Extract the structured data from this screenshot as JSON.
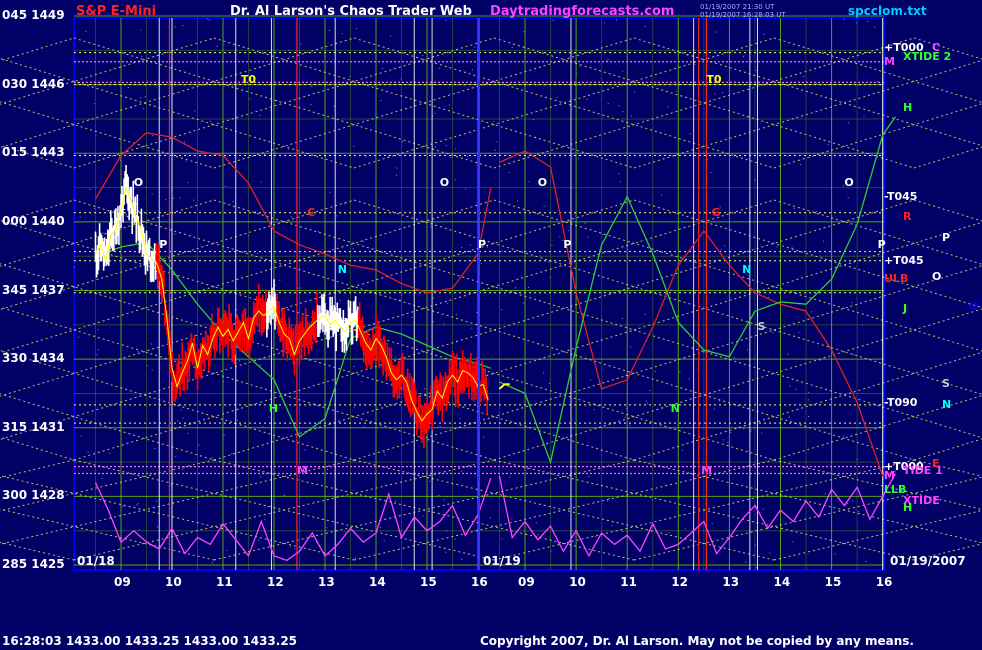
{
  "header": {
    "symbol": "S&P E-Mini",
    "title": "Dr. Al Larson's Chaos Trader Web",
    "site": "Daytradingforecasts.com",
    "stamp_line1": "01/19/2007 21:30 UT",
    "stamp_line2": "01/19/2007 16:28:03 UT",
    "file": "spcclom.txt"
  },
  "footer": {
    "quote": "16:28:03  1433.00  1433.25  1433.00  1433.25",
    "copyright": "Copyright 2007, Dr. Al Larson. May not be copied by any means."
  },
  "colors": {
    "background": "#000066",
    "frame": "#0000ff",
    "grid_green": "#66cc00",
    "white_line": "#ffffff",
    "red_line": "#ff2222",
    "dotted_yellow": "#ffff66",
    "dotted_magenta": "#ff66ff",
    "green_curve": "#33cc33",
    "red_curve": "#dd2222",
    "magenta_curve": "#ff44ff",
    "bar_white": "#ffffff",
    "bar_red": "#ff0000",
    "bar_yellow": "#ffff00"
  },
  "chart_data": {
    "type": "line",
    "title": "S&P E-Mini",
    "xlabel": "",
    "ylabel": "",
    "grid": true,
    "y_labels": [
      "045 1449",
      "030 1446",
      "015 1443",
      "000 1440",
      "345 1437",
      "330 1434",
      "315 1431",
      "300 1428",
      "285 1425"
    ],
    "ylim": [
      1425,
      1449
    ],
    "x_ticks": [
      "09",
      "10",
      "11",
      "12",
      "13",
      "14",
      "15",
      "16",
      "09",
      "10",
      "11",
      "12",
      "13",
      "14",
      "15",
      "16"
    ],
    "dates": [
      "01/18",
      "01/19",
      "01/19/2007"
    ],
    "session_hours": [
      8.5,
      16.25
    ],
    "price_series": [
      {
        "t": 8.5,
        "v": 1438.6
      },
      {
        "t": 8.6,
        "v": 1439.0
      },
      {
        "t": 8.7,
        "v": 1438.3
      },
      {
        "t": 8.8,
        "v": 1439.4
      },
      {
        "t": 8.9,
        "v": 1439.7
      },
      {
        "t": 9.0,
        "v": 1440.5
      },
      {
        "t": 9.1,
        "v": 1441.5
      },
      {
        "t": 9.2,
        "v": 1440.9
      },
      {
        "t": 9.3,
        "v": 1440.2
      },
      {
        "t": 9.4,
        "v": 1439.6
      },
      {
        "t": 9.5,
        "v": 1438.6
      },
      {
        "t": 9.6,
        "v": 1438.4
      },
      {
        "t": 9.7,
        "v": 1438.2
      },
      {
        "t": 9.8,
        "v": 1437.5
      },
      {
        "t": 9.9,
        "v": 1435.8
      },
      {
        "t": 10.0,
        "v": 1433.6
      },
      {
        "t": 10.1,
        "v": 1432.8
      },
      {
        "t": 10.2,
        "v": 1433.4
      },
      {
        "t": 10.3,
        "v": 1433.9
      },
      {
        "t": 10.4,
        "v": 1434.7
      },
      {
        "t": 10.5,
        "v": 1433.6
      },
      {
        "t": 10.6,
        "v": 1434.6
      },
      {
        "t": 10.7,
        "v": 1434.2
      },
      {
        "t": 10.8,
        "v": 1434.9
      },
      {
        "t": 10.9,
        "v": 1435.4
      },
      {
        "t": 11.0,
        "v": 1435.0
      },
      {
        "t": 11.1,
        "v": 1435.3
      },
      {
        "t": 11.2,
        "v": 1434.8
      },
      {
        "t": 11.3,
        "v": 1435.2
      },
      {
        "t": 11.4,
        "v": 1435.6
      },
      {
        "t": 11.5,
        "v": 1434.9
      },
      {
        "t": 11.6,
        "v": 1435.8
      },
      {
        "t": 11.7,
        "v": 1436.1
      },
      {
        "t": 11.8,
        "v": 1435.9
      },
      {
        "t": 11.9,
        "v": 1436.1
      },
      {
        "t": 12.0,
        "v": 1436.3
      },
      {
        "t": 12.1,
        "v": 1435.6
      },
      {
        "t": 12.2,
        "v": 1435.1
      },
      {
        "t": 12.3,
        "v": 1434.9
      },
      {
        "t": 12.4,
        "v": 1434.2
      },
      {
        "t": 12.5,
        "v": 1434.8
      },
      {
        "t": 12.6,
        "v": 1435.1
      },
      {
        "t": 12.7,
        "v": 1435.4
      },
      {
        "t": 12.8,
        "v": 1435.6
      },
      {
        "t": 12.9,
        "v": 1435.8
      },
      {
        "t": 13.0,
        "v": 1435.9
      },
      {
        "t": 13.1,
        "v": 1435.5
      },
      {
        "t": 13.2,
        "v": 1435.7
      },
      {
        "t": 13.3,
        "v": 1435.4
      },
      {
        "t": 13.4,
        "v": 1435.2
      },
      {
        "t": 13.5,
        "v": 1435.6
      },
      {
        "t": 13.6,
        "v": 1435.7
      },
      {
        "t": 13.7,
        "v": 1435.2
      },
      {
        "t": 13.8,
        "v": 1434.7
      },
      {
        "t": 13.9,
        "v": 1434.4
      },
      {
        "t": 14.0,
        "v": 1434.9
      },
      {
        "t": 14.1,
        "v": 1434.6
      },
      {
        "t": 14.2,
        "v": 1434.1
      },
      {
        "t": 14.3,
        "v": 1433.4
      },
      {
        "t": 14.4,
        "v": 1433.1
      },
      {
        "t": 14.5,
        "v": 1433.3
      },
      {
        "t": 14.6,
        "v": 1433.0
      },
      {
        "t": 14.7,
        "v": 1432.2
      },
      {
        "t": 14.8,
        "v": 1431.7
      },
      {
        "t": 14.9,
        "v": 1431.3
      },
      {
        "t": 15.0,
        "v": 1431.6
      },
      {
        "t": 15.1,
        "v": 1431.8
      },
      {
        "t": 15.2,
        "v": 1432.6
      },
      {
        "t": 15.3,
        "v": 1432.3
      },
      {
        "t": 15.4,
        "v": 1433.0
      },
      {
        "t": 15.5,
        "v": 1433.3
      },
      {
        "t": 15.6,
        "v": 1433.0
      },
      {
        "t": 15.7,
        "v": 1433.5
      },
      {
        "t": 15.8,
        "v": 1433.4
      },
      {
        "t": 15.9,
        "v": 1433.2
      },
      {
        "t": 16.0,
        "v": 1432.8
      },
      {
        "t": 16.1,
        "v": 1432.9
      },
      {
        "t": 16.2,
        "v": 1432.2
      }
    ],
    "today_tail": [
      {
        "t": 8.5,
        "v": 1432.7
      },
      {
        "t": 8.6,
        "v": 1432.9
      },
      {
        "t": 8.7,
        "v": 1432.9
      }
    ],
    "green_curve_day1": [
      {
        "t": 8.5,
        "v": 1438.5
      },
      {
        "t": 9.0,
        "v": 1438.9
      },
      {
        "t": 9.5,
        "v": 1439.1
      },
      {
        "t": 10.0,
        "v": 1437.9
      },
      {
        "t": 10.5,
        "v": 1436.4
      },
      {
        "t": 11.0,
        "v": 1435.1
      },
      {
        "t": 11.5,
        "v": 1434.1
      },
      {
        "t": 12.0,
        "v": 1433.1
      },
      {
        "t": 12.5,
        "v": 1430.6
      },
      {
        "t": 13.0,
        "v": 1431.4
      },
      {
        "t": 13.5,
        "v": 1434.9
      },
      {
        "t": 14.0,
        "v": 1435.4
      },
      {
        "t": 14.5,
        "v": 1435.1
      },
      {
        "t": 15.0,
        "v": 1434.6
      },
      {
        "t": 15.5,
        "v": 1434.1
      },
      {
        "t": 16.0,
        "v": 1433.8
      },
      {
        "t": 16.25,
        "v": 1433.6
      }
    ],
    "green_curve_day2": [
      {
        "t": 8.5,
        "v": 1433.0
      },
      {
        "t": 9.0,
        "v": 1432.5
      },
      {
        "t": 9.5,
        "v": 1429.5
      },
      {
        "t": 10.0,
        "v": 1434.5
      },
      {
        "t": 10.5,
        "v": 1439.0
      },
      {
        "t": 11.0,
        "v": 1441.1
      },
      {
        "t": 11.5,
        "v": 1438.6
      },
      {
        "t": 12.0,
        "v": 1435.6
      },
      {
        "t": 12.5,
        "v": 1434.4
      },
      {
        "t": 13.0,
        "v": 1434.1
      },
      {
        "t": 13.5,
        "v": 1436.1
      },
      {
        "t": 14.0,
        "v": 1436.5
      },
      {
        "t": 14.5,
        "v": 1436.4
      },
      {
        "t": 15.0,
        "v": 1437.5
      },
      {
        "t": 15.5,
        "v": 1439.9
      },
      {
        "t": 16.0,
        "v": 1443.8
      },
      {
        "t": 16.25,
        "v": 1444.6
      }
    ],
    "red_curve_day1": [
      {
        "t": 8.5,
        "v": 1441.0
      },
      {
        "t": 9.0,
        "v": 1442.9
      },
      {
        "t": 9.5,
        "v": 1443.9
      },
      {
        "t": 10.0,
        "v": 1443.7
      },
      {
        "t": 10.5,
        "v": 1443.1
      },
      {
        "t": 11.0,
        "v": 1442.9
      },
      {
        "t": 11.5,
        "v": 1441.7
      },
      {
        "t": 12.0,
        "v": 1439.6
      },
      {
        "t": 12.5,
        "v": 1439.0
      },
      {
        "t": 13.0,
        "v": 1438.6
      },
      {
        "t": 13.5,
        "v": 1438.1
      },
      {
        "t": 14.0,
        "v": 1437.9
      },
      {
        "t": 14.5,
        "v": 1437.3
      },
      {
        "t": 15.0,
        "v": 1436.9
      },
      {
        "t": 15.5,
        "v": 1437.1
      },
      {
        "t": 16.0,
        "v": 1438.6
      },
      {
        "t": 16.25,
        "v": 1441.5
      }
    ],
    "red_curve_day2": [
      {
        "t": 8.5,
        "v": 1442.6
      },
      {
        "t": 9.0,
        "v": 1443.1
      },
      {
        "t": 9.5,
        "v": 1442.4
      },
      {
        "t": 10.0,
        "v": 1436.9
      },
      {
        "t": 10.5,
        "v": 1432.7
      },
      {
        "t": 11.0,
        "v": 1433.1
      },
      {
        "t": 11.5,
        "v": 1435.4
      },
      {
        "t": 12.0,
        "v": 1438.1
      },
      {
        "t": 12.5,
        "v": 1439.6
      },
      {
        "t": 13.0,
        "v": 1438.1
      },
      {
        "t": 13.5,
        "v": 1436.9
      },
      {
        "t": 14.0,
        "v": 1436.4
      },
      {
        "t": 14.5,
        "v": 1436.1
      },
      {
        "t": 15.0,
        "v": 1434.4
      },
      {
        "t": 15.5,
        "v": 1432.1
      },
      {
        "t": 16.0,
        "v": 1428.9
      },
      {
        "t": 16.25,
        "v": 1429.1
      }
    ],
    "magenta_curve_day1": [
      {
        "t": 8.5,
        "v": 1428.6
      },
      {
        "t": 8.75,
        "v": 1427.4
      },
      {
        "t": 9.0,
        "v": 1426.0
      },
      {
        "t": 9.25,
        "v": 1426.5
      },
      {
        "t": 9.5,
        "v": 1426.0
      },
      {
        "t": 9.75,
        "v": 1425.7
      },
      {
        "t": 10.0,
        "v": 1426.6
      },
      {
        "t": 10.25,
        "v": 1425.5
      },
      {
        "t": 10.5,
        "v": 1426.2
      },
      {
        "t": 10.75,
        "v": 1425.9
      },
      {
        "t": 11.0,
        "v": 1426.8
      },
      {
        "t": 11.25,
        "v": 1426.1
      },
      {
        "t": 11.5,
        "v": 1425.4
      },
      {
        "t": 11.75,
        "v": 1426.9
      },
      {
        "t": 12.0,
        "v": 1425.4
      },
      {
        "t": 12.25,
        "v": 1425.2
      },
      {
        "t": 12.5,
        "v": 1425.6
      },
      {
        "t": 12.75,
        "v": 1426.4
      },
      {
        "t": 13.0,
        "v": 1425.4
      },
      {
        "t": 13.25,
        "v": 1425.9
      },
      {
        "t": 13.5,
        "v": 1426.6
      },
      {
        "t": 13.75,
        "v": 1426.0
      },
      {
        "t": 14.0,
        "v": 1426.4
      },
      {
        "t": 14.25,
        "v": 1428.1
      },
      {
        "t": 14.5,
        "v": 1426.2
      },
      {
        "t": 14.75,
        "v": 1427.1
      },
      {
        "t": 15.0,
        "v": 1426.5
      },
      {
        "t": 15.25,
        "v": 1426.9
      },
      {
        "t": 15.5,
        "v": 1427.6
      },
      {
        "t": 15.75,
        "v": 1426.3
      },
      {
        "t": 16.0,
        "v": 1427.2
      },
      {
        "t": 16.25,
        "v": 1428.8
      }
    ],
    "magenta_curve_day2": [
      {
        "t": 8.5,
        "v": 1428.9
      },
      {
        "t": 8.75,
        "v": 1426.2
      },
      {
        "t": 9.0,
        "v": 1426.9
      },
      {
        "t": 9.25,
        "v": 1426.1
      },
      {
        "t": 9.5,
        "v": 1426.7
      },
      {
        "t": 9.75,
        "v": 1425.6
      },
      {
        "t": 10.0,
        "v": 1426.5
      },
      {
        "t": 10.25,
        "v": 1425.4
      },
      {
        "t": 10.5,
        "v": 1426.4
      },
      {
        "t": 10.75,
        "v": 1425.9
      },
      {
        "t": 11.0,
        "v": 1426.3
      },
      {
        "t": 11.25,
        "v": 1425.6
      },
      {
        "t": 11.5,
        "v": 1426.8
      },
      {
        "t": 11.75,
        "v": 1425.7
      },
      {
        "t": 12.0,
        "v": 1425.9
      },
      {
        "t": 12.25,
        "v": 1426.4
      },
      {
        "t": 12.5,
        "v": 1426.9
      },
      {
        "t": 12.75,
        "v": 1425.5
      },
      {
        "t": 13.0,
        "v": 1426.2
      },
      {
        "t": 13.25,
        "v": 1427.0
      },
      {
        "t": 13.5,
        "v": 1427.6
      },
      {
        "t": 13.75,
        "v": 1426.6
      },
      {
        "t": 14.0,
        "v": 1427.4
      },
      {
        "t": 14.25,
        "v": 1426.9
      },
      {
        "t": 14.5,
        "v": 1427.8
      },
      {
        "t": 14.75,
        "v": 1427.1
      },
      {
        "t": 15.0,
        "v": 1428.3
      },
      {
        "t": 15.25,
        "v": 1427.6
      },
      {
        "t": 15.5,
        "v": 1428.4
      },
      {
        "t": 15.75,
        "v": 1427.0
      },
      {
        "t": 16.0,
        "v": 1428.0
      },
      {
        "t": 16.25,
        "v": 1429.0
      }
    ],
    "vertical_markers": {
      "white_day1": [
        9.75,
        10.0,
        11.25,
        11.95,
        13.2,
        14.75,
        15.1
      ],
      "red_day1": [
        9.95,
        12.45
      ],
      "white_day2": [
        9.9,
        12.3,
        13.4,
        13.55,
        16.0
      ],
      "red_day2": [
        12.4,
        12.55
      ]
    },
    "hlines_dotted_magenta": [
      1447.0,
      1446.1,
      1429.3,
      1429.0
    ],
    "hlines_dotted_yellow": [
      1447.4,
      1446.0,
      1442.9,
      1440.4,
      1438.7,
      1438.3,
      1436.9,
      1432.0,
      1431.2
    ],
    "annotations_day1": [
      {
        "text": "T0",
        "t": 11.35,
        "v": 1446.2,
        "color": "#ffff00"
      },
      {
        "text": "O",
        "t": 9.25,
        "v": 1441.7,
        "color": "#ffffff"
      },
      {
        "text": "O",
        "t": 15.25,
        "v": 1441.7,
        "color": "#ffffff"
      },
      {
        "text": "P",
        "t": 9.75,
        "v": 1439.0,
        "color": "#ffffff"
      },
      {
        "text": "P",
        "t": 16.0,
        "v": 1439.0,
        "color": "#ffffff"
      },
      {
        "text": "C",
        "t": 12.65,
        "v": 1440.4,
        "color": "#ff2222"
      },
      {
        "text": "N",
        "t": 13.25,
        "v": 1437.9,
        "color": "#00ffff"
      },
      {
        "text": "H",
        "t": 11.9,
        "v": 1431.8,
        "color": "#33ff33"
      },
      {
        "text": "M",
        "t": 12.45,
        "v": 1429.1,
        "color": "#ff44ff"
      }
    ],
    "annotations_day2": [
      {
        "text": "T0",
        "t": 12.55,
        "v": 1446.2,
        "color": "#ffff00"
      },
      {
        "text": "O",
        "t": 9.25,
        "v": 1441.7,
        "color": "#ffffff"
      },
      {
        "text": "O",
        "t": 15.25,
        "v": 1441.7,
        "color": "#ffffff"
      },
      {
        "text": "P",
        "t": 9.75,
        "v": 1439.0,
        "color": "#ffffff"
      },
      {
        "text": "P",
        "t": 15.9,
        "v": 1439.0,
        "color": "#ffffff"
      },
      {
        "text": "G",
        "t": 12.65,
        "v": 1440.4,
        "color": "#ff2222"
      },
      {
        "text": "N",
        "t": 13.25,
        "v": 1437.9,
        "color": "#00ffff"
      },
      {
        "text": "S",
        "t": 13.55,
        "v": 1435.4,
        "color": "#cccccc"
      },
      {
        "text": "N",
        "t": 11.85,
        "v": 1431.8,
        "color": "#33ff33"
      },
      {
        "text": "M",
        "t": 12.45,
        "v": 1429.1,
        "color": "#ff44ff"
      }
    ],
    "right_labels": [
      {
        "text": "+T000",
        "v": 1447.6,
        "color": "#ffffff",
        "col": 0
      },
      {
        "text": "C",
        "v": 1447.6,
        "color": "#ff44ff",
        "col": 2
      },
      {
        "text": "M",
        "v": 1447.0,
        "color": "#ff44ff",
        "col": 0
      },
      {
        "text": "XTIDE 2",
        "v": 1447.2,
        "color": "#33ff33",
        "col": 1
      },
      {
        "text": "H",
        "v": 1445.0,
        "color": "#33ff33",
        "col": 1
      },
      {
        "text": "-T045",
        "v": 1441.1,
        "color": "#ffffff",
        "col": 0
      },
      {
        "text": "R",
        "v": 1440.2,
        "color": "#ff2222",
        "col": 1
      },
      {
        "text": "P",
        "v": 1439.3,
        "color": "#ffffff",
        "col": 3
      },
      {
        "text": "+T045",
        "v": 1438.3,
        "color": "#ffffff",
        "col": 0
      },
      {
        "text": "ULB",
        "v": 1437.5,
        "color": "#ff2222",
        "col": 0
      },
      {
        "text": "O",
        "v": 1437.6,
        "color": "#ffffff",
        "col": 2
      },
      {
        "text": "J",
        "v": 1436.2,
        "color": "#33ff33",
        "col": 1
      },
      {
        "text": "U",
        "v": 1436.3,
        "color": "#0000ff",
        "col": 4
      },
      {
        "text": "S",
        "v": 1432.9,
        "color": "#cccccc",
        "col": 3
      },
      {
        "text": "-T090",
        "v": 1432.1,
        "color": "#ffffff",
        "col": 0
      },
      {
        "text": "N",
        "v": 1432.0,
        "color": "#00ffff",
        "col": 3
      },
      {
        "text": "+T000",
        "v": 1429.3,
        "color": "#ffffff",
        "col": 0
      },
      {
        "text": "TIDE 1",
        "v": 1429.1,
        "color": "#ff44ff",
        "col": 1
      },
      {
        "text": "E",
        "v": 1429.4,
        "color": "#ff2222",
        "col": 2
      },
      {
        "text": "M",
        "v": 1428.9,
        "color": "#ff44ff",
        "col": 0
      },
      {
        "text": "LLB",
        "v": 1428.3,
        "color": "#33ff33",
        "col": 0
      },
      {
        "text": "XTIDE",
        "v": 1427.8,
        "color": "#ff44ff",
        "col": 1
      },
      {
        "text": "H",
        "v": 1427.5,
        "color": "#33ff33",
        "col": 1
      }
    ]
  }
}
